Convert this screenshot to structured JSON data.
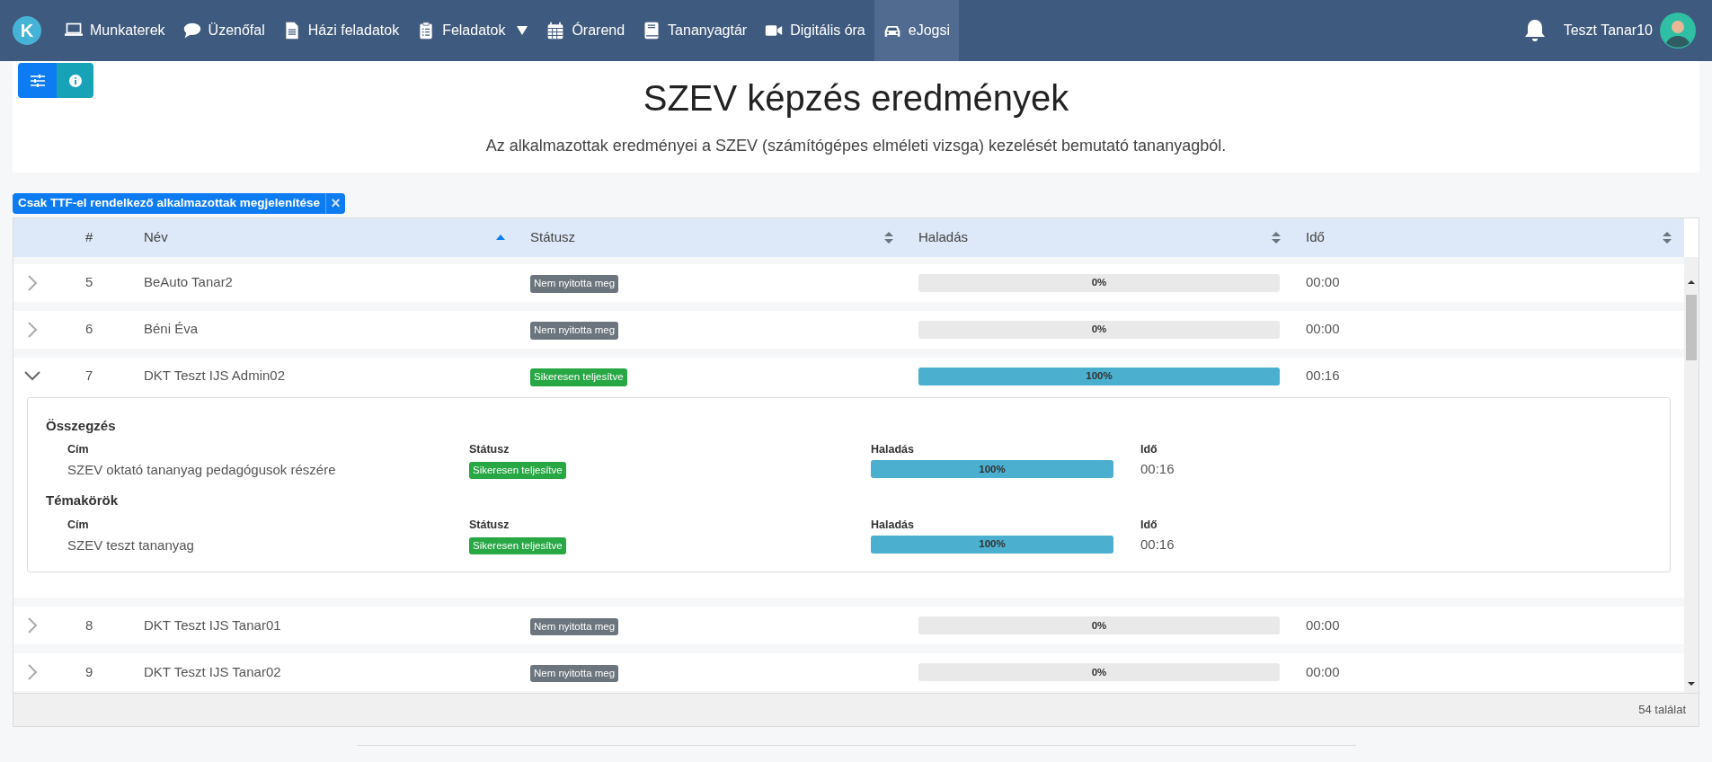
{
  "navbar": {
    "logo": "K",
    "items": [
      {
        "label": "Munkaterek",
        "selected": false,
        "dropdown": false
      },
      {
        "label": "Üzenőfal",
        "selected": false,
        "dropdown": false
      },
      {
        "label": "Házi feladatok",
        "selected": false,
        "dropdown": false
      },
      {
        "label": "Feladatok",
        "selected": false,
        "dropdown": true
      },
      {
        "label": "Órarend",
        "selected": false,
        "dropdown": false
      },
      {
        "label": "Tananyagtár",
        "selected": false,
        "dropdown": false
      },
      {
        "label": "Digitális óra",
        "selected": false,
        "dropdown": false
      },
      {
        "label": "eJogsi",
        "selected": true,
        "dropdown": false
      }
    ],
    "user": "Teszt Tanar10"
  },
  "header": {
    "title": "SZEV képzés eredmények",
    "subtitle": "Az alkalmazottak eredményei a SZEV (számítógépes elméleti vizsga) kezelését bemutató tananyagból."
  },
  "filter_chip": {
    "label": "Csak TTF-el rendelkező alkalmazottak megjelenítése",
    "close": "×"
  },
  "table": {
    "columns": [
      {
        "label": "#",
        "sortable": false
      },
      {
        "label": "Név",
        "sorted": true,
        "sortable": true
      },
      {
        "label": "Státusz",
        "sorted": false,
        "sortable": true
      },
      {
        "label": "Haladás",
        "sorted": false,
        "sortable": true
      },
      {
        "label": "Idő",
        "sorted": false,
        "sortable": true
      }
    ],
    "rows": [
      {
        "number": "5",
        "name": "BeAuto Tanar2",
        "status": "Nem nyitotta meg",
        "completed": false,
        "level": 0,
        "progress": "0%",
        "time": "00:00",
        "expanded": false
      },
      {
        "number": "6",
        "name": "Béni Éva",
        "status": "Nem nyitotta meg",
        "completed": false,
        "level": 0,
        "progress": "0%",
        "time": "00:00",
        "expanded": false
      },
      {
        "number": "7",
        "name": "DKT Teszt IJS Admin02",
        "status": "Sikeresen teljesítve",
        "completed": true,
        "level": 1,
        "progress": "100%",
        "time": "00:16",
        "expanded": true,
        "details": [
          {
            "heading": "Összegzés",
            "columns": [
              "Cím",
              "Státusz",
              "Haladás",
              "Idő"
            ],
            "title": "SZEV oktató tananyag pedagógusok részére",
            "status": "Sikeresen teljesítve",
            "completed": true,
            "level": 1,
            "progress": "100%",
            "time": "00:16"
          },
          {
            "heading": "Témakörök",
            "columns": [
              "Cím",
              "Státusz",
              "Haladás",
              "Idő"
            ],
            "title": "SZEV teszt tananyag",
            "status": "Sikeresen teljesítve",
            "completed": true,
            "level": 1,
            "progress": "100%",
            "time": "00:16"
          }
        ]
      },
      {
        "number": "8",
        "name": "DKT Teszt IJS Tanar01",
        "status": "Nem nyitotta meg",
        "completed": false,
        "level": 0,
        "progress": "0%",
        "time": "00:00",
        "expanded": false
      },
      {
        "number": "9",
        "name": "DKT Teszt IJS Tanar02",
        "status": "Nem nyitotta meg",
        "completed": false,
        "level": 0,
        "progress": "0%",
        "time": "00:00",
        "expanded": false
      }
    ],
    "footer": "54 találat"
  }
}
